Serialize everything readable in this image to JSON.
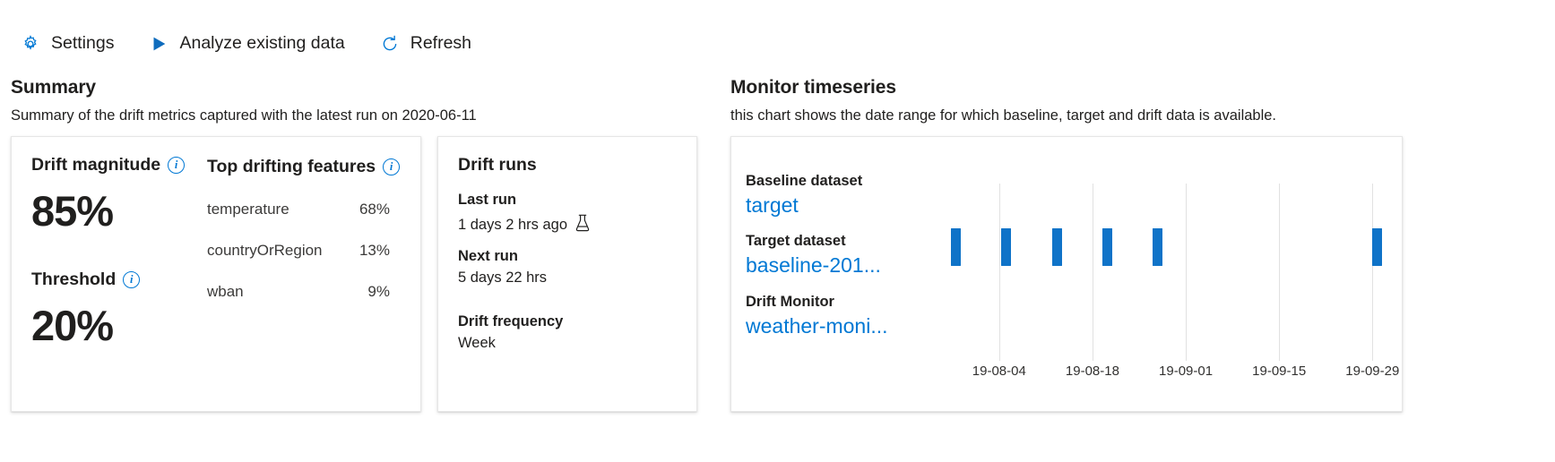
{
  "toolbar": {
    "items": [
      {
        "label": "Settings",
        "icon": "gear-icon",
        "name": "settings"
      },
      {
        "label": "Analyze existing data",
        "icon": "play-icon",
        "name": "analyze-existing-data"
      },
      {
        "label": "Refresh",
        "icon": "refresh-icon",
        "name": "refresh"
      }
    ]
  },
  "summary": {
    "title": "Summary",
    "subtitle": "Summary of the drift metrics captured with the latest run on 2020-06-11",
    "drift_magnitude": {
      "label": "Drift magnitude",
      "value": "85%",
      "info_icon": "info-icon"
    },
    "threshold": {
      "label": "Threshold",
      "value": "20%",
      "info_icon": "info-icon"
    },
    "top_drifting_features": {
      "label": "Top drifting features",
      "info_icon": "info-icon",
      "rows": [
        {
          "name": "temperature",
          "value": "68%"
        },
        {
          "name": "countryOrRegion",
          "value": "13%"
        },
        {
          "name": "wban",
          "value": "9%"
        }
      ]
    }
  },
  "drift_runs": {
    "title": "Drift runs",
    "last_run_label": "Last run",
    "last_run_value": "1 days 2 hrs ago",
    "last_run_icon": "flask-icon",
    "next_run_label": "Next run",
    "next_run_value": "5 days 22 hrs",
    "frequency_label": "Drift frequency",
    "frequency_value": "Week"
  },
  "monitor_timeseries": {
    "title": "Monitor timeseries",
    "subtitle": "this chart shows the date range for which baseline, target and drift data is available.",
    "legend": [
      {
        "label": "Baseline dataset",
        "link": "target"
      },
      {
        "label": "Target dataset",
        "link": "baseline-201..."
      },
      {
        "label": "Drift Monitor",
        "link": "weather-moni..."
      }
    ],
    "accent_color": "#0078d4",
    "bar_color": "#0f73c8"
  },
  "chart_data": {
    "type": "bar",
    "title": "Monitor timeseries",
    "subtitle": "this chart shows the date range for which baseline, target and drift data is available.",
    "xlabel": "",
    "ylabel": "",
    "grid": true,
    "legend_position": "left",
    "tick_labels": [
      "19-08-04",
      "19-08-18",
      "19-09-01",
      "19-09-15",
      "19-09-29"
    ],
    "tick_positions_pct": [
      18.5,
      38.0,
      57.5,
      77.0,
      96.5
    ],
    "gridline_positions_pct": [
      18.5,
      38.0,
      57.5,
      77.0,
      96.5
    ],
    "series": [
      {
        "name": "Drift Monitor",
        "color": "#0f73c8",
        "points": [
          {
            "x_pct": 8.5,
            "value": 1
          },
          {
            "x_pct": 19.0,
            "value": 1
          },
          {
            "x_pct": 29.5,
            "value": 1
          },
          {
            "x_pct": 40.0,
            "value": 1
          },
          {
            "x_pct": 50.5,
            "value": 1
          },
          {
            "x_pct": 96.5,
            "value": 1
          }
        ]
      }
    ]
  }
}
